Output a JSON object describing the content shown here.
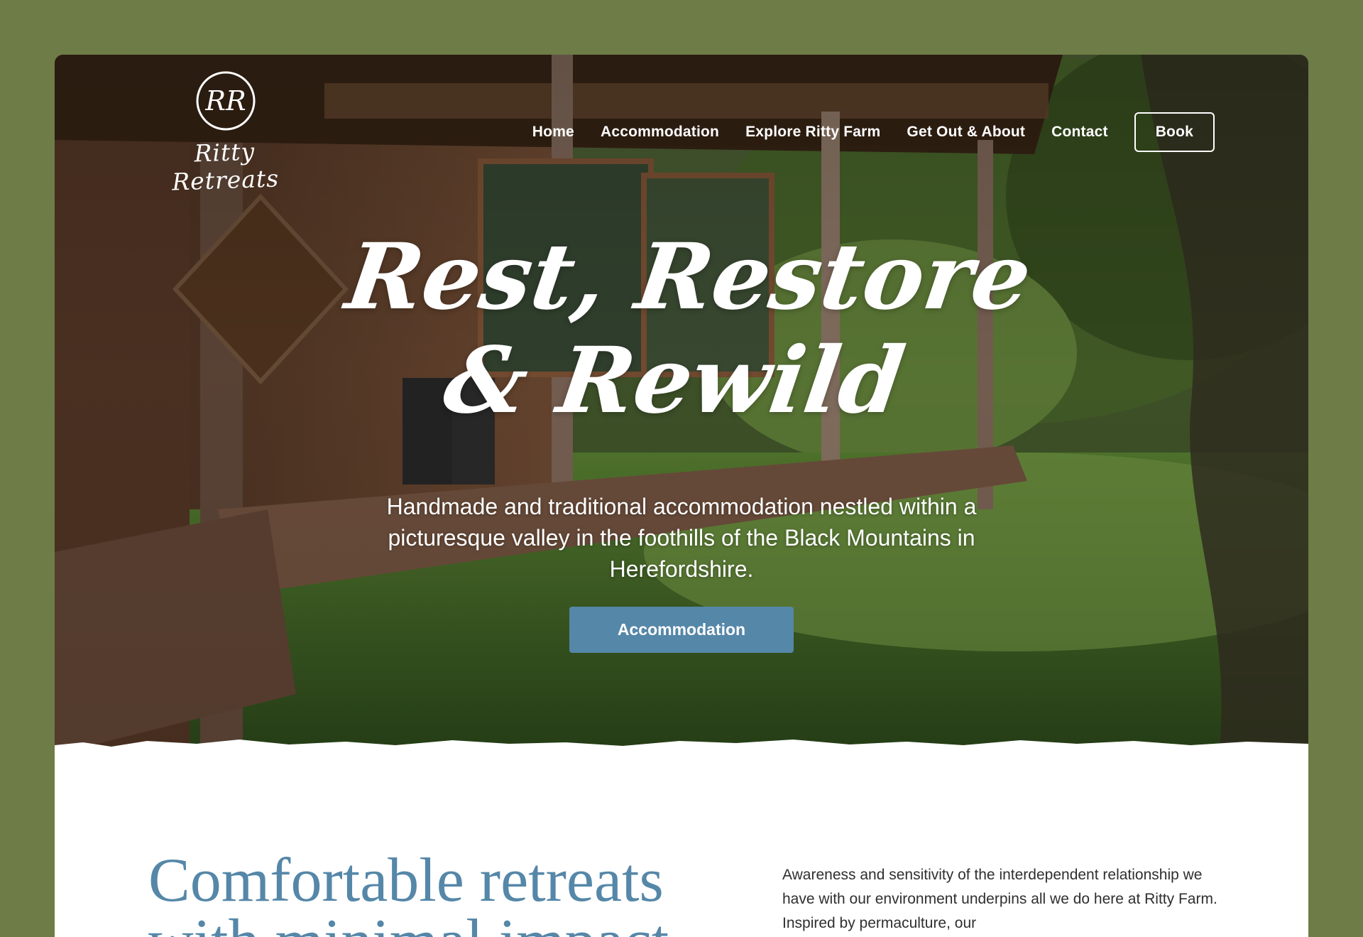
{
  "colors": {
    "page_background": "#6e7c48",
    "accent_blue": "#5587a8",
    "text_white": "#ffffff",
    "body_text": "#2f2f2f"
  },
  "logo": {
    "monogram": "RR",
    "text": "Ritty Retreats"
  },
  "nav": {
    "items": [
      {
        "label": "Home"
      },
      {
        "label": "Accommodation"
      },
      {
        "label": "Explore Ritty Farm"
      },
      {
        "label": "Get Out & About"
      },
      {
        "label": "Contact"
      }
    ],
    "book_label": "Book"
  },
  "hero": {
    "title_line1": "Rest, Restore",
    "title_line2": "& Rewild",
    "subtitle": "Handmade and traditional accommodation nestled within a picturesque valley in the foothills of the Black Mountains in Herefordshire.",
    "cta_label": "Accommodation"
  },
  "intro": {
    "heading": "Comfortable retreats with minimal impact",
    "body": "Awareness and sensitivity of the interdependent relationship we have with our environment underpins all we do here at Ritty Farm. Inspired by permaculture, our"
  }
}
